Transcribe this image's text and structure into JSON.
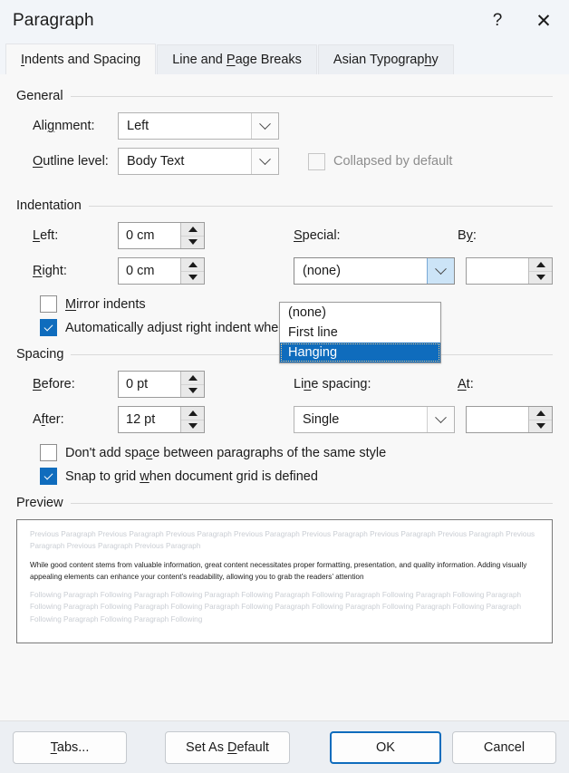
{
  "window": {
    "title": "Paragraph",
    "help_icon": "?",
    "close_icon": "✕"
  },
  "tabs": [
    {
      "label": "Indents and Spacing",
      "accel": "I",
      "active": true
    },
    {
      "label": "Line and Page Breaks",
      "accel": "P",
      "active": false
    },
    {
      "label": "Asian Typography",
      "accel": "h",
      "active": false
    }
  ],
  "general": {
    "heading": "General",
    "alignment_label": "Alignment:",
    "alignment_accel": "g",
    "alignment_value": "Left",
    "outline_label": "Outline level:",
    "outline_accel": "O",
    "outline_value": "Body Text",
    "collapsed_label": "Collapsed by default",
    "collapsed_checked": false,
    "collapsed_disabled": true
  },
  "indentation": {
    "heading": "Indentation",
    "left_label": "Left:",
    "left_accel": "L",
    "left_value": "0 cm",
    "right_label": "Right:",
    "right_accel": "R",
    "right_value": "0 cm",
    "special_label": "Special:",
    "special_accel": "S",
    "special_value": "(none)",
    "by_label": "By:",
    "by_accel": "y",
    "by_value": "",
    "mirror_label": "Mirror indents",
    "mirror_accel": "M",
    "mirror_checked": false,
    "auto_adjust_label": "Automatically adjust right indent when document grid is defined",
    "auto_adjust_accel": "j",
    "auto_adjust_checked": true,
    "special_options": [
      "(none)",
      "First line",
      "Hanging"
    ],
    "special_selected_option": "Hanging",
    "dropdown_open": true
  },
  "spacing": {
    "heading": "Spacing",
    "before_label": "Before:",
    "before_accel": "B",
    "before_value": "0 pt",
    "after_label": "After:",
    "after_accel": "f",
    "after_value": "12 pt",
    "line_spacing_label": "Line spacing:",
    "line_spacing_accel": "n",
    "line_spacing_value": "Single",
    "at_label": "At:",
    "at_accel": "A",
    "at_value": "",
    "dont_add_label": "Don't add space between paragraphs of the same style",
    "dont_add_accel": "c",
    "dont_add_checked": false,
    "snap_label": "Snap to grid when document grid is defined",
    "snap_accel": "w",
    "snap_checked": true
  },
  "preview": {
    "heading": "Preview",
    "previous_text": "Previous Paragraph Previous Paragraph Previous Paragraph Previous Paragraph Previous Paragraph Previous Paragraph Previous Paragraph Previous Paragraph Previous Paragraph Previous Paragraph",
    "body_text": "While good content stems from valuable information, great content necessitates proper formatting, presentation, and quality information. Adding visually appealing elements can enhance your content’s readability, allowing you to grab the readers’ attention",
    "following_text": "Following Paragraph Following Paragraph Following Paragraph Following Paragraph Following Paragraph Following Paragraph Following Paragraph Following Paragraph Following Paragraph Following Paragraph Following Paragraph Following Paragraph Following Paragraph Following Paragraph Following Paragraph Following Paragraph Following"
  },
  "footer": {
    "tabs_label": "Tabs...",
    "tabs_accel": "T",
    "set_default_label": "Set As Default",
    "set_default_accel": "D",
    "ok_label": "OK",
    "cancel_label": "Cancel"
  },
  "colors": {
    "accent": "#0f6cbd",
    "titlebar_bg": "#f2f5f9",
    "dialog_bg": "#f8f8f8",
    "footer_bg": "#eceff3",
    "highlight_text": "#ffffff"
  }
}
